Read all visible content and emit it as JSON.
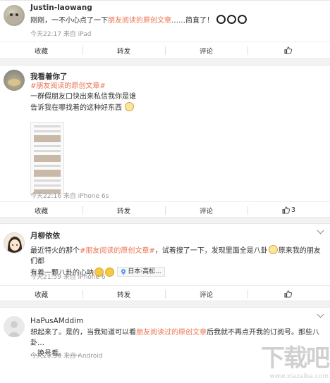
{
  "posts": [
    {
      "user": "Justin-laowang",
      "text_before": "刚刚，一不小心点了一下",
      "highlight": "朋友阅读的原创文章",
      "text_after": "……简直了！",
      "time": "今天22:17",
      "source": "来自 iPad",
      "actions": {
        "favorite": "收藏",
        "repost": "转发",
        "comment": "评论",
        "like": ""
      }
    },
    {
      "user": "我看着你了",
      "topic": "#朋友阅读的原创文章#",
      "line1": "一群假朋友口快出来私信我你是谁",
      "line2": "告诉我在哪找着的这种好东西",
      "time": "今天22:16",
      "source": "来自 iPhone 6s",
      "actions": {
        "favorite": "收藏",
        "repost": "转发",
        "comment": "评论",
        "like": "3"
      }
    },
    {
      "user": "月柳依依",
      "text_before": "最近特火的那个",
      "topic": "#朋友阅读的原创文章#",
      "text_mid": "，试着搜了一下，发现里面全是八卦",
      "text_after": "原来我的朋友们都",
      "line2": "有着一颗八卦的心呐",
      "location": "日本·高松...",
      "time": "今天21:59",
      "source": "来自 iPhone 6",
      "actions": {
        "favorite": "收藏",
        "repost": "转发",
        "comment": "评论",
        "like": ""
      }
    },
    {
      "user": "HaPusAMddim",
      "text_before": "想起来了。是的，当我知道可以看",
      "highlight": "朋友阅读过的原创文章",
      "text_after": "后我就不再点开我的订阅号。那些八卦…",
      "line2": "…换号看。……",
      "time": "今天20:36",
      "source": "来自 Android"
    }
  ],
  "watermark": {
    "main": "下载吧",
    "sub": "www.xiazaiba.com"
  },
  "colors": {
    "highlight": "#eb7350",
    "meta": "#999999",
    "background": "#f2f2f2"
  }
}
